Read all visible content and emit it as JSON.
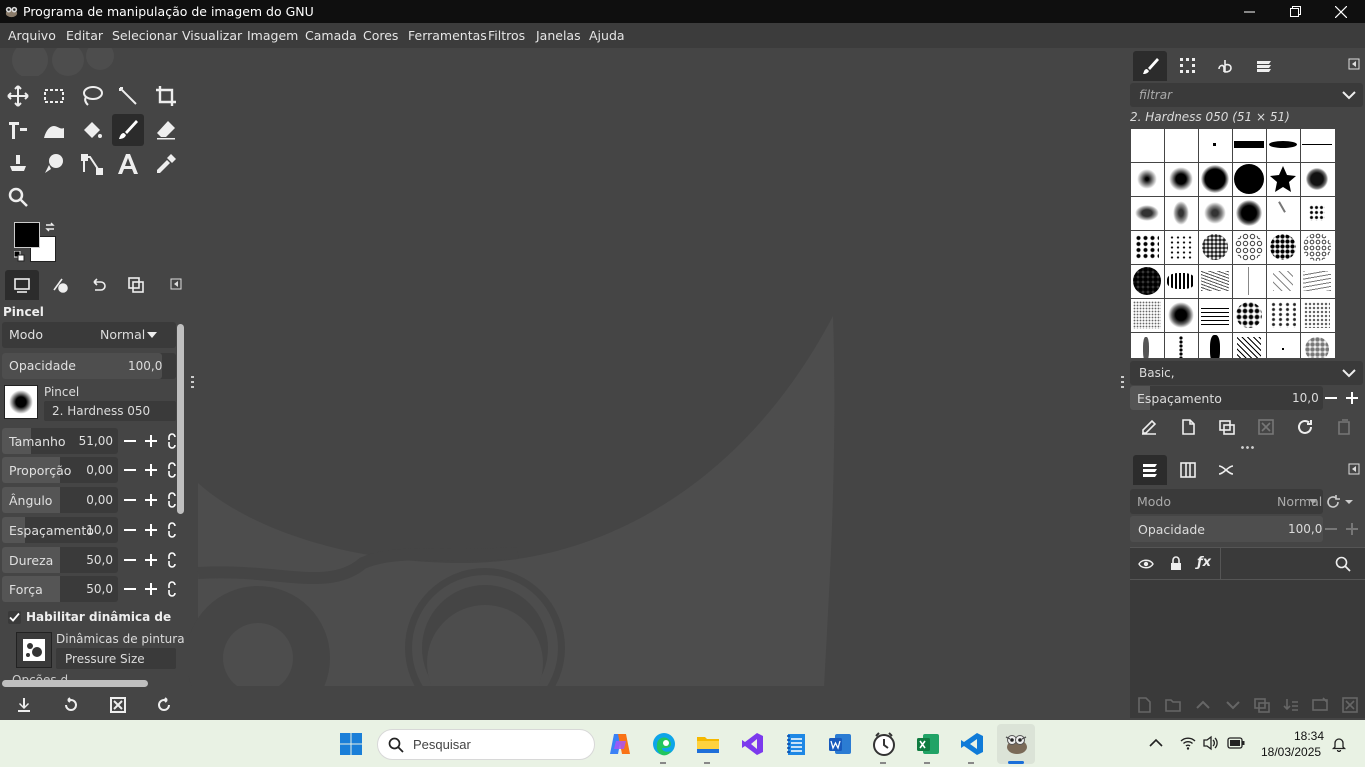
{
  "window": {
    "title": "Programa de manipulação de imagem do GNU",
    "controls": [
      "minimize",
      "maximize",
      "close"
    ]
  },
  "menu": [
    "Arquivo",
    "Editar",
    "Selecionar",
    "Visualizar",
    "Imagem",
    "Camada",
    "Cores",
    "Ferramentas",
    "Filtros",
    "Janelas",
    "Ajuda"
  ],
  "tool_options": {
    "title": "Pincel",
    "mode_label": "Modo",
    "mode_value": "Normal",
    "opacity_label": "Opacidade",
    "opacity_value": "100,0",
    "brush_label": "Pincel",
    "brush_name": "2. Hardness 050",
    "sliders": [
      {
        "label": "Tamanho",
        "value": "51,00",
        "fraction": 0.25
      },
      {
        "label": "Proporção",
        "value": "0,00",
        "fraction": 0.5
      },
      {
        "label": "Ângulo",
        "value": "0,00",
        "fraction": 0.5
      },
      {
        "label": "Espaçamento",
        "value": "10,0",
        "fraction": 0.2
      },
      {
        "label": "Dureza",
        "value": "50,0",
        "fraction": 0.5
      },
      {
        "label": "Força",
        "value": "50,0",
        "fraction": 0.5
      }
    ],
    "dynamics_checkbox": "Habilitar dinâmica de pintura",
    "dynamics_label": "Dinâmicas de pintura",
    "dynamics_value": "Pressure Size",
    "cut_label": "Opções d"
  },
  "brushes_panel": {
    "filter_placeholder": "filtrar",
    "selected_brush": "2. Hardness 050 (51 × 51)",
    "tag_value": "Basic,",
    "spacing_label": "Espaçamento",
    "spacing_value": "10,0"
  },
  "layers_panel": {
    "mode_label": "Modo",
    "mode_value": "Normal",
    "opacity_label": "Opacidade",
    "opacity_value": "100,0"
  },
  "taskbar": {
    "search_placeholder": "Pesquisar",
    "time": "18:34",
    "date": "18/03/2025"
  },
  "colors": {
    "titlebar": "#0f0f0f",
    "background": "#454545",
    "accent_taskbar": "#e9f2e4"
  }
}
